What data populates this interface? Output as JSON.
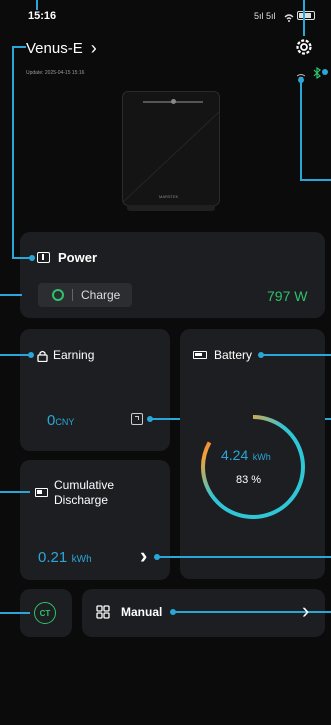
{
  "status_bar": {
    "time": "15:16",
    "signal_text": "5ıl 5ıl",
    "wifi_glyph": "◔",
    "battery_glyph": "▭"
  },
  "header": {
    "device_name": "Venus-E",
    "chevron": "›",
    "update_text": "Update: 2025-04-15 15:16",
    "settings_glyph": "⚙",
    "wifi_glyph": "•",
    "bluetooth_glyph": "✱"
  },
  "device": {
    "brand_label": "MARSTEK"
  },
  "power_card": {
    "title": "Power",
    "mode_label": "Charge",
    "value": "797 W",
    "accent_color": "#2ec26a"
  },
  "earning_card": {
    "title": "Earning",
    "value": "0",
    "unit": "CNY",
    "accent_color": "#2aa7d8"
  },
  "battery_card": {
    "title": "Battery",
    "energy_value": "4.24",
    "energy_unit": "kWh",
    "percent_text": "83 %",
    "percent": 0.83
  },
  "discharge_card": {
    "title_line1": "Cumulative",
    "title_line2": "Discharge",
    "value": "0.21",
    "unit": "kWh",
    "chevron": "›"
  },
  "ct_button": {
    "label": "CT"
  },
  "manual_card": {
    "label": "Manual",
    "chevron": "›"
  },
  "colors": {
    "annotation": "#2aa7d8",
    "card_bg": "#1d1e21",
    "value_blue": "#2aa7d8",
    "value_green": "#2ec26a"
  }
}
